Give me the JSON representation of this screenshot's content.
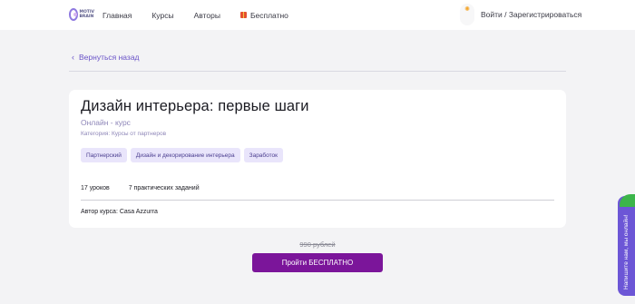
{
  "header": {
    "logo_text_1": "MOTIV",
    "logo_text_2": "BRAIN",
    "nav": [
      {
        "label": "Главная"
      },
      {
        "label": "Курсы"
      },
      {
        "label": "Авторы"
      },
      {
        "label": "Бесплатно",
        "icon": "gift-icon"
      }
    ],
    "bulb_icon": "lightbulb-icon",
    "login_label": "Войти / Зарегистрироваться"
  },
  "back_link": {
    "label": "Вернуться назад",
    "icon": "chevron-left-icon"
  },
  "course": {
    "title": "Дизайн интерьера: первые шаги",
    "type": "Онлайн - курс",
    "category": "Категория: Курсы от партнеров",
    "tags": [
      "Партнерский",
      "Дизайн и декорирование интерьера",
      "Заработок"
    ],
    "lessons": "17 уроков",
    "assignments": "7 практических заданий",
    "author": "Автор курса: Casa Azzurra"
  },
  "pricing": {
    "old_price": "990 рублей",
    "cta_label": "Пройти БЕСПЛАТНО"
  },
  "chat_widget": {
    "label": "Напишите нам, мы онлайн!"
  },
  "colors": {
    "accent": "#6a53c8",
    "cta": "#7b159a",
    "tag_bg": "#e9e5fb",
    "widget": "#6c56d6"
  }
}
